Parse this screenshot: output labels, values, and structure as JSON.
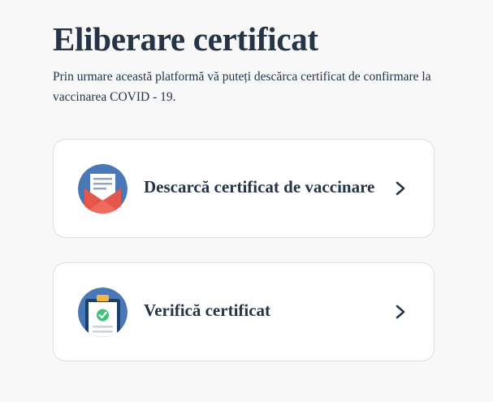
{
  "header": {
    "title": "Eliberare certificat",
    "description": "Prin urmare această platformă vă puteți descărca certificat de confirmare la vaccinarea COVID - 19."
  },
  "options": [
    {
      "label": "Descarcă certificat de vaccinare",
      "icon": "envelope-certificate-icon"
    },
    {
      "label": "Verifică certificat",
      "icon": "clipboard-check-icon"
    }
  ],
  "colors": {
    "text": "#253447",
    "background": "#f8f8f8",
    "icon_circle": "#4a77b5",
    "envelope_red": "#e5574b",
    "check_green": "#3cc47c"
  }
}
